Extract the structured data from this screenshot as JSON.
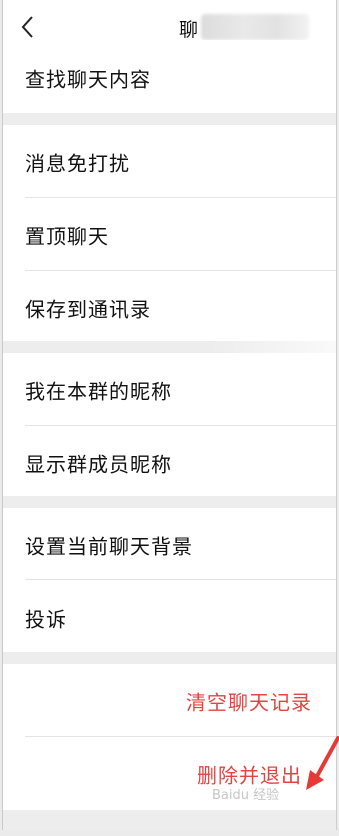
{
  "header": {
    "back_icon": "chevron-left-icon",
    "title": "聊"
  },
  "groups": [
    {
      "items": [
        {
          "label": "查找聊天内容"
        }
      ]
    },
    {
      "items": [
        {
          "label": "消息免打扰"
        },
        {
          "label": "置顶聊天"
        },
        {
          "label": "保存到通讯录"
        }
      ]
    },
    {
      "items": [
        {
          "label": "我在本群的昵称"
        },
        {
          "label": "显示群成员昵称"
        }
      ]
    },
    {
      "items": [
        {
          "label": "设置当前聊天背景"
        },
        {
          "label": "投诉"
        }
      ]
    }
  ],
  "actions": {
    "clear_label": "清空聊天记录",
    "delete_label": "删除并退出",
    "color": "#e64340"
  },
  "watermark": {
    "text": "Baidu 经验"
  },
  "colors": {
    "background": "#ededed",
    "card": "#ffffff",
    "annotation_arrow": "#e53935"
  }
}
